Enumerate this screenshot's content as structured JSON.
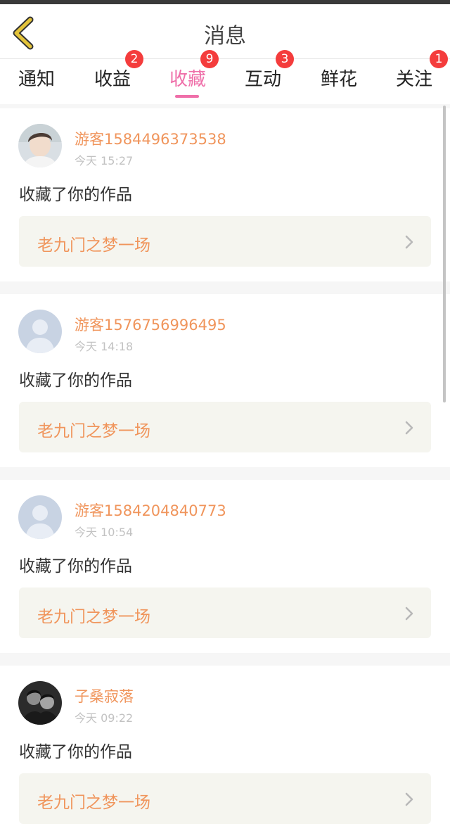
{
  "header": {
    "title": "消息"
  },
  "tabs": [
    {
      "label": "通知",
      "badge": ""
    },
    {
      "label": "收益",
      "badge": "2"
    },
    {
      "label": "收藏",
      "badge": "9"
    },
    {
      "label": "互动",
      "badge": "3"
    },
    {
      "label": "鲜花",
      "badge": ""
    },
    {
      "label": "关注",
      "badge": "1"
    }
  ],
  "active_tab": "收藏",
  "notifications": [
    {
      "username": "游客1584496373538",
      "time": "今天 15:27",
      "action": "收藏了你的作品",
      "work": "老九门之梦一场",
      "avatar": "photo-young-man"
    },
    {
      "username": "游客1576756996495",
      "time": "今天 14:18",
      "action": "收藏了你的作品",
      "work": "老九门之梦一场",
      "avatar": "default-user"
    },
    {
      "username": "游客1584204840773",
      "time": "今天 10:54",
      "action": "收藏了你的作品",
      "work": "老九门之梦一场",
      "avatar": "default-user"
    },
    {
      "username": "子桑寂落",
      "time": "今天 09:22",
      "action": "收藏了你的作品",
      "work": "老九门之梦一场",
      "avatar": "photo-two-people"
    }
  ],
  "colors": {
    "accent": "#ef6fa9",
    "username": "#f0955c",
    "badge": "#f43c3c",
    "back_icon": "#e3c33a"
  }
}
